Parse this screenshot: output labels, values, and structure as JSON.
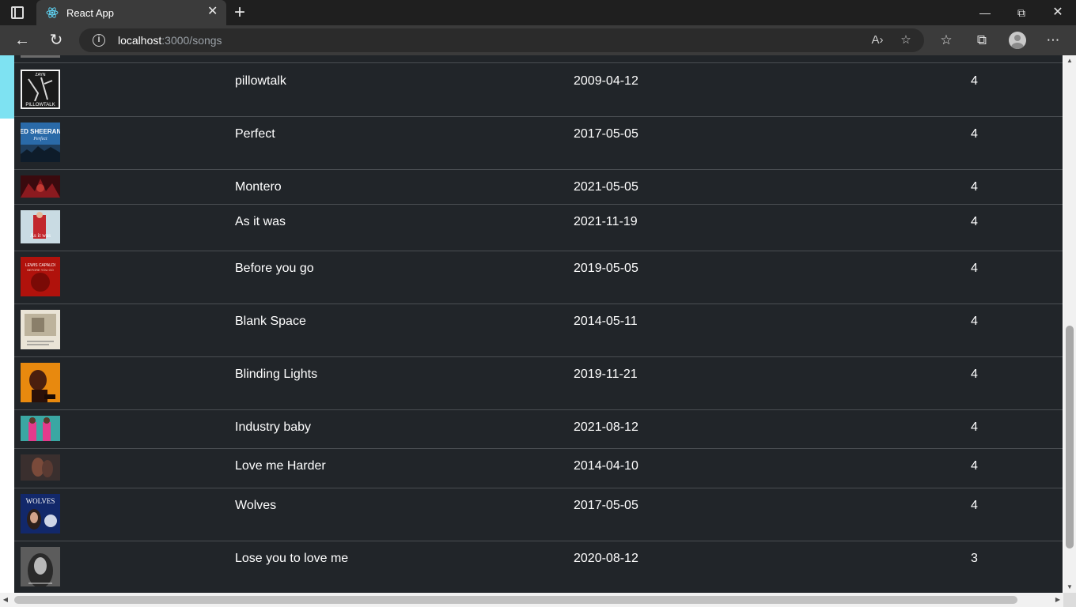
{
  "browser": {
    "tab_title": "React App",
    "url_host": "localhost",
    "url_path": ":3000/songs",
    "icons": {
      "tab_actions": "tab-actions-icon",
      "favicon": "react-logo-icon",
      "close": "close-icon",
      "new_tab": "plus-icon",
      "back": "back-arrow-icon",
      "refresh": "refresh-icon",
      "site_info": "info-icon",
      "read_aloud": "read-aloud-icon",
      "add_favorite": "add-favorite-icon",
      "favorites": "favorites-icon",
      "collections": "collections-icon",
      "profile": "profile-avatar",
      "more": "more-icon"
    }
  },
  "songs": [
    {
      "title": "pillowtalk",
      "date": "2009-04-12",
      "rating": "4",
      "cover_label": "ZAYN"
    },
    {
      "title": "Perfect",
      "date": "2017-05-05",
      "rating": "4",
      "cover_label": "ED SHEERAN"
    },
    {
      "title": "Montero",
      "date": "2021-05-05",
      "rating": "4",
      "cover_label": ""
    },
    {
      "title": "As it was",
      "date": "2021-11-19",
      "rating": "4",
      "cover_label": "As it was"
    },
    {
      "title": "Before you go",
      "date": "2019-05-05",
      "rating": "4",
      "cover_label": "LEWIS CAPALDI"
    },
    {
      "title": "Blank Space",
      "date": "2014-05-11",
      "rating": "4",
      "cover_label": ""
    },
    {
      "title": "Blinding Lights",
      "date": "2019-11-21",
      "rating": "4",
      "cover_label": ""
    },
    {
      "title": "Industry baby",
      "date": "2021-08-12",
      "rating": "4",
      "cover_label": ""
    },
    {
      "title": "Love me Harder",
      "date": "2014-04-10",
      "rating": "4",
      "cover_label": ""
    },
    {
      "title": "Wolves",
      "date": "2017-05-05",
      "rating": "4",
      "cover_label": "WOLVES"
    },
    {
      "title": "Lose you to love me",
      "date": "2020-08-12",
      "rating": "3",
      "cover_label": ""
    }
  ],
  "colors": {
    "table_bg": "#212529",
    "row_border": "#4a4e52",
    "text": "#ffffff",
    "accent": "#7ee2f2"
  }
}
